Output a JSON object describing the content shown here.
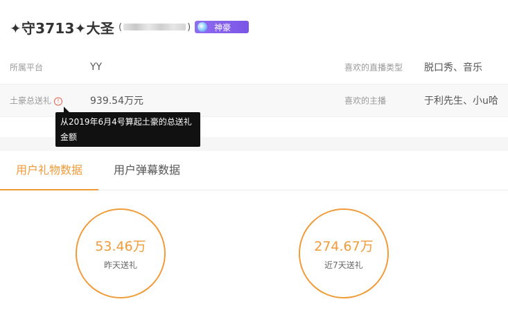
{
  "user": {
    "name": "✦守3713✦大圣",
    "uid_open": "(",
    "uid_close": ")",
    "badge_label": "神豪"
  },
  "info": {
    "platform_label": "所属平台",
    "platform_value": "YY",
    "fav_type_label": "喜欢的直播类型",
    "fav_type_value": "脱口秀、音乐",
    "total_gift_label": "土豪总送礼",
    "total_gift_value": "939.54万元",
    "fav_anchor_label": "喜欢的主播",
    "fav_anchor_value": "于利先生、小u哈"
  },
  "tooltip": {
    "text": "从2019年6月4号算起土豪的总送礼金额"
  },
  "tabs": [
    {
      "label": "用户礼物数据",
      "active": true
    },
    {
      "label": "用户弹幕数据",
      "active": false
    }
  ],
  "stats": [
    {
      "value": "53.46万",
      "label": "昨天送礼"
    },
    {
      "value": "274.67万",
      "label": "近7天送礼"
    }
  ],
  "colors": {
    "accent": "#f19a38",
    "badge": "#7b55e6",
    "warning": "#e8604c"
  }
}
